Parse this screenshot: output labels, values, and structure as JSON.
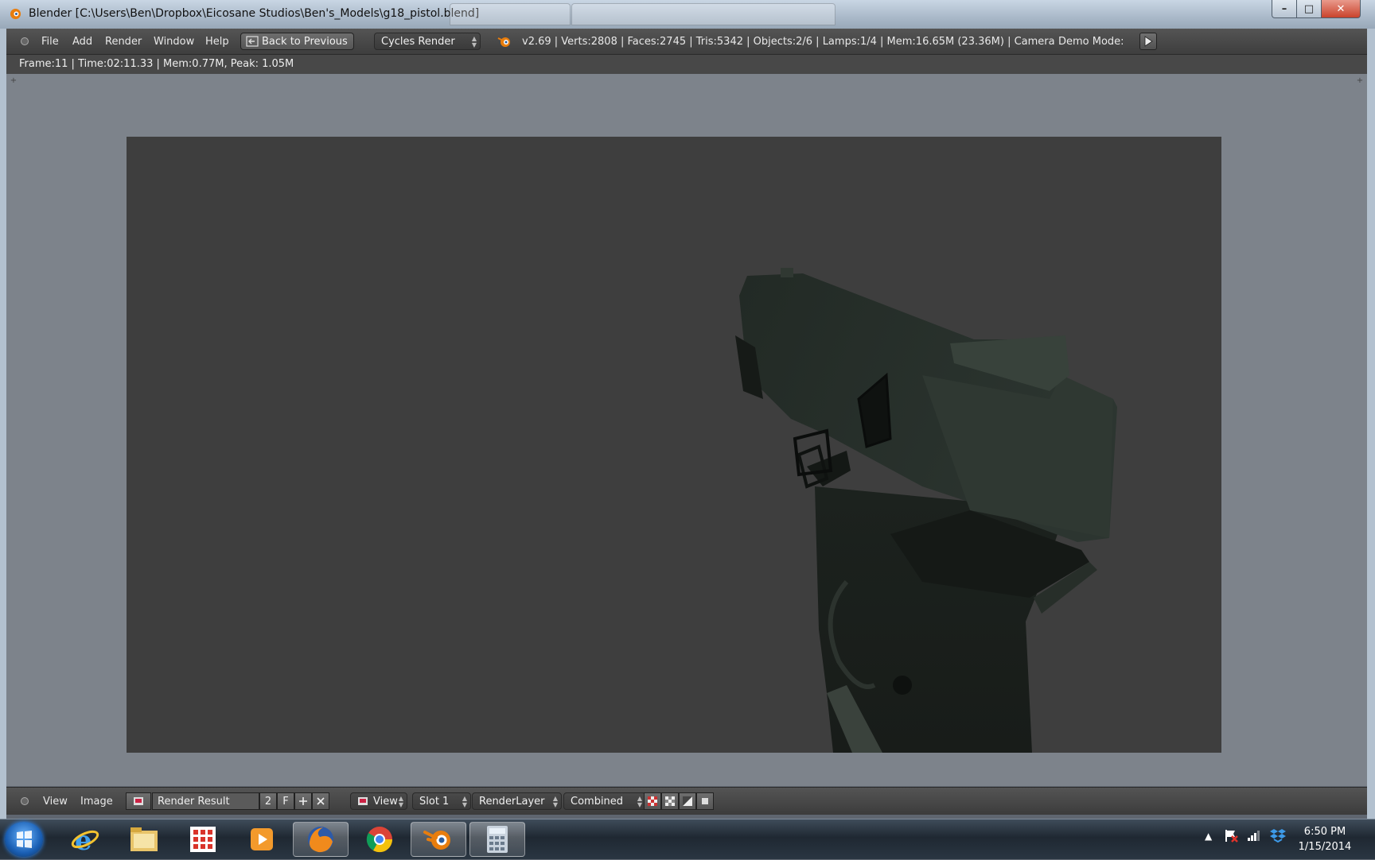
{
  "window": {
    "title": "Blender [C:\\Users\\Ben\\Dropbox\\Eicosane Studios\\Ben's_Models\\g18_pistol.blend]",
    "controls": {
      "minimize": "–",
      "maximize": "□",
      "close": "✕"
    }
  },
  "header": {
    "menu": [
      "File",
      "Add",
      "Render",
      "Window",
      "Help"
    ],
    "back_button": "Back to Previous",
    "render_engine": "Cycles Render",
    "stats": "v2.69 | Verts:2808 | Faces:2745 | Tris:5342 | Objects:2/6 | Lamps:1/4 | Mem:16.65M (23.36M) | Camera",
    "demo_mode_label": "Demo Mode:"
  },
  "infobar": {
    "text": "Frame:11 | Time:02:11.33 | Mem:0.77M, Peak: 1.05M"
  },
  "footer": {
    "view_menu": "View",
    "image_menu": "Image",
    "image_name": "Render Result",
    "users_count": "2",
    "fake_user": "F",
    "display_view": "View",
    "slot": "Slot 1",
    "render_layer": "RenderLayer",
    "pass": "Combined"
  },
  "taskbar": {
    "apps": [
      "internet-explorer",
      "file-explorer",
      "app-grid",
      "media-player",
      "firefox",
      "chrome",
      "blender",
      "calculator"
    ],
    "active_app": "blender",
    "time": "6:50 PM",
    "date": "1/15/2014"
  },
  "colors": {
    "blender_header": "#4a4a4a",
    "editor_bg": "#7d838b",
    "render_bg": "#3e3e3e",
    "accent_orange": "#e87d0d"
  }
}
